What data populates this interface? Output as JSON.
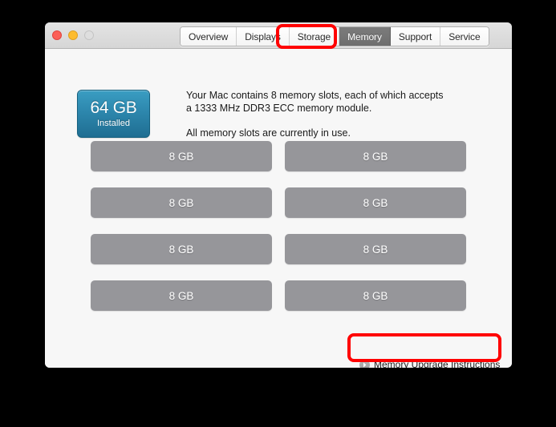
{
  "window": {
    "traffic_lights": [
      {
        "name": "close",
        "color": "#fc5f57"
      },
      {
        "name": "minimize",
        "color": "#fdbc2e"
      },
      {
        "name": "zoom",
        "color": "#dedede"
      }
    ]
  },
  "tabs": [
    {
      "label": "Overview",
      "selected": false
    },
    {
      "label": "Displays",
      "selected": false
    },
    {
      "label": "Storage",
      "selected": false
    },
    {
      "label": "Memory",
      "selected": true
    },
    {
      "label": "Support",
      "selected": false
    },
    {
      "label": "Service",
      "selected": false
    }
  ],
  "badge": {
    "amount": "64 GB",
    "state": "Installed",
    "color": "#2d87ad"
  },
  "description": {
    "line1": "Your Mac contains 8 memory slots, each of which accepts a 1333 MHz DDR3 ECC memory module.",
    "line2": "All memory slots are currently in use."
  },
  "slots": [
    {
      "label": "8 GB"
    },
    {
      "label": "8 GB"
    },
    {
      "label": "8 GB"
    },
    {
      "label": "8 GB"
    },
    {
      "label": "8 GB"
    },
    {
      "label": "8 GB"
    },
    {
      "label": "8 GB"
    },
    {
      "label": "8 GB"
    }
  ],
  "upgrade_link": {
    "label": "Memory Upgrade Instructions",
    "icon": "disclosure-arrow-right-icon"
  },
  "annotations": {
    "color": "#ff0000",
    "memory_tab_note": "Memory",
    "upgrade_note": "Memory Upgrade Instructions"
  }
}
